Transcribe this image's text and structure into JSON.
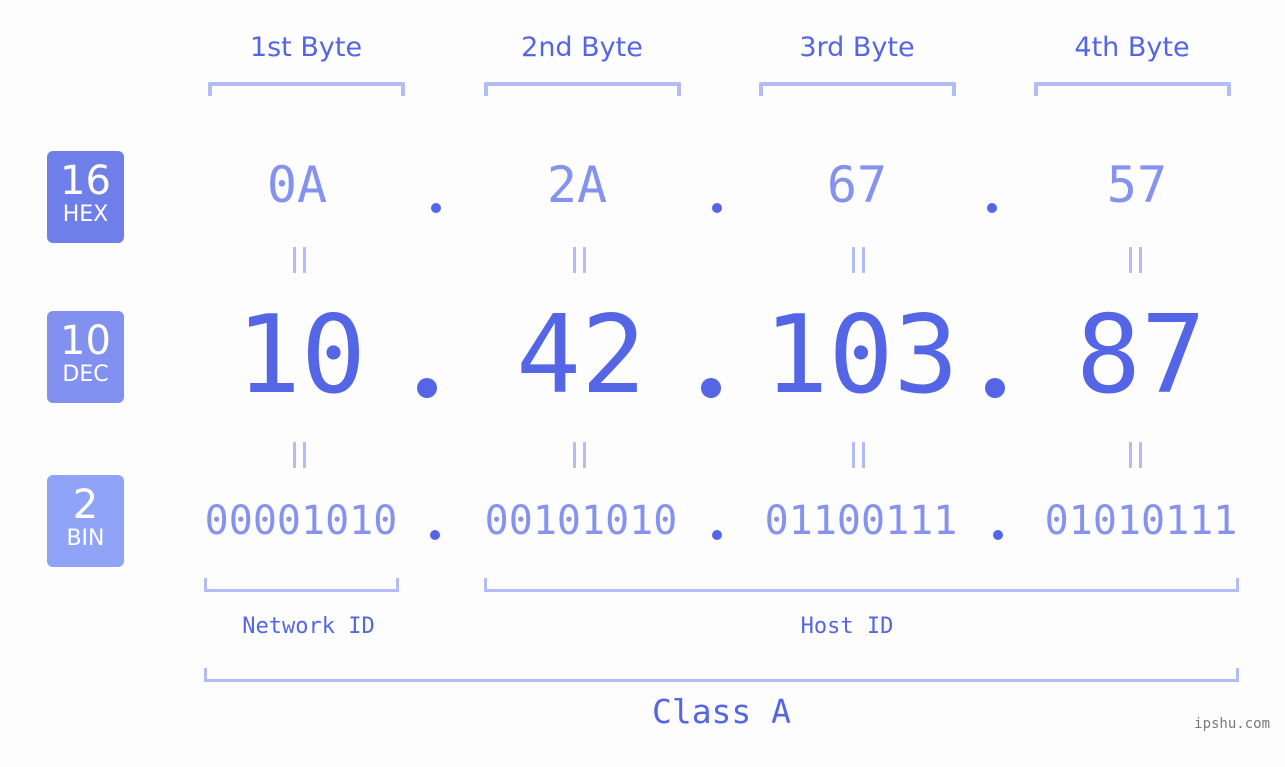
{
  "bytes": [
    {
      "header": "1st Byte",
      "hex": "0A",
      "dec": "10",
      "bin": "00001010"
    },
    {
      "header": "2nd Byte",
      "hex": "2A",
      "dec": "42",
      "bin": "00101010"
    },
    {
      "header": "3rd Byte",
      "hex": "67",
      "dec": "103",
      "bin": "01100111"
    },
    {
      "header": "4th Byte",
      "hex": "57",
      "dec": "87",
      "bin": "01010111"
    }
  ],
  "badges": {
    "hex": {
      "number": "16",
      "label": "HEX",
      "color": "#6f7fe9"
    },
    "dec": {
      "number": "10",
      "label": "DEC",
      "color": "#8290f0"
    },
    "bin": {
      "number": "2",
      "label": "BIN",
      "color": "#8fa3f7"
    }
  },
  "labels": {
    "network_id": "Network ID",
    "host_id": "Host ID",
    "class": "Class A"
  },
  "watermark": "ipshu.com",
  "colors": {
    "primary": "#5466e6",
    "secondary": "#8592ef",
    "bracket": "#b3bcf5"
  }
}
